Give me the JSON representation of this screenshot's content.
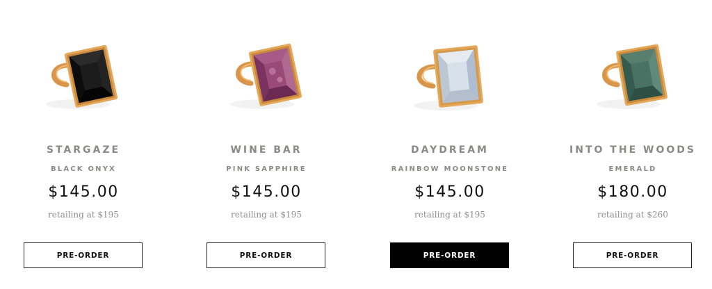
{
  "products": [
    {
      "name": "STARGAZE",
      "stone": "BLACK ONYX",
      "price": "$145.00",
      "retail": "retailing at $195",
      "button": "PRE-ORDER",
      "gem_icon": "black-onyx-ring-icon",
      "gem_color": "#141414"
    },
    {
      "name": "WINE BAR",
      "stone": "PINK SAPPHIRE",
      "price": "$145.00",
      "retail": "retailing at $195",
      "button": "PRE-ORDER",
      "gem_icon": "pink-sapphire-ring-icon",
      "gem_color": "#8a3a6a"
    },
    {
      "name": "DAYDREAM",
      "stone": "RAINBOW MOONSTONE",
      "price": "$145.00",
      "retail": "retailing at $195",
      "button": "PRE-ORDER",
      "button_state": "hover",
      "gem_icon": "rainbow-moonstone-ring-icon",
      "gem_color": "#c9d3df"
    },
    {
      "name": "INTO THE WOODS",
      "stone": "EMERALD",
      "price": "$180.00",
      "retail": "retailing at $260",
      "button": "PRE-ORDER",
      "gem_icon": "emerald-ring-icon",
      "gem_color": "#3f6659"
    }
  ],
  "colors": {
    "gold": "#e0a453",
    "name_text": "#8a8a88",
    "price_text": "#111111",
    "retail_text": "#8f8f8f",
    "button_border": "#222222",
    "button_active_bg": "#000000"
  }
}
